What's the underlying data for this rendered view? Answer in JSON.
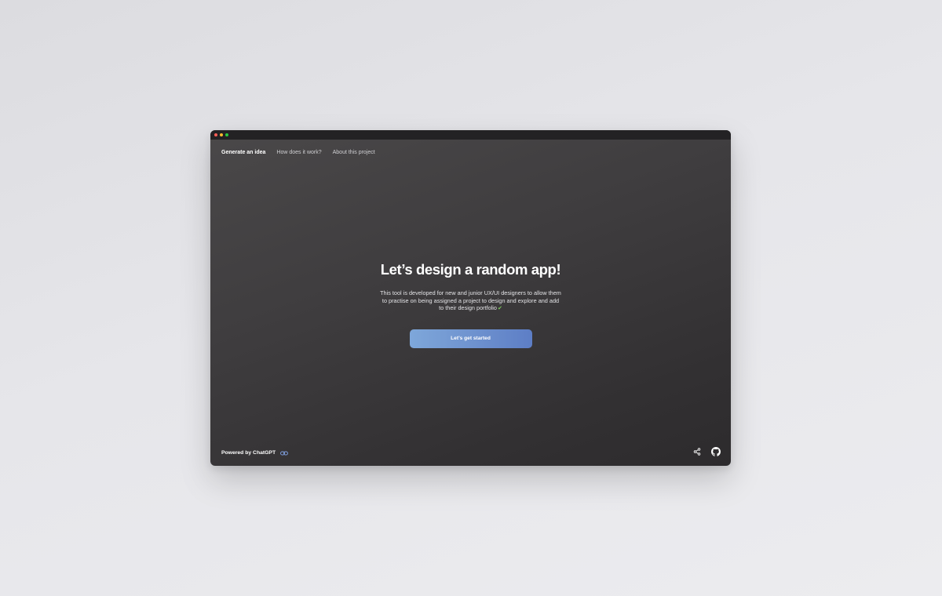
{
  "window": {
    "controls": [
      {
        "name": "close",
        "color": "#ff5f57"
      },
      {
        "name": "minimize",
        "color": "#febc2e"
      },
      {
        "name": "maximize",
        "color": "#28c840"
      }
    ]
  },
  "nav": {
    "items": [
      {
        "label": "Generate an idea",
        "active": true
      },
      {
        "label": "How does it work?",
        "active": false
      },
      {
        "label": "About this project",
        "active": false
      }
    ]
  },
  "hero": {
    "title": "Let’s design a random app!",
    "description": "This tool is developed for new and junior UX/UI designers to allow them to practise on being assigned a project to design and explore and add to their design portfolio",
    "description_icon": "seedling-icon",
    "cta_label": "Let’s get started"
  },
  "footer": {
    "powered_by": "Powered by ChatGPT",
    "link_icon": "link-icon",
    "share_icon": "share-icon",
    "github_icon": "github-icon"
  },
  "colors": {
    "accent_start": "#7ea7da",
    "accent_end": "#5d7ec6",
    "window_bg": "#3f3d3f",
    "titlebar_bg": "#232224",
    "link_icon": "#7f9fe0"
  }
}
